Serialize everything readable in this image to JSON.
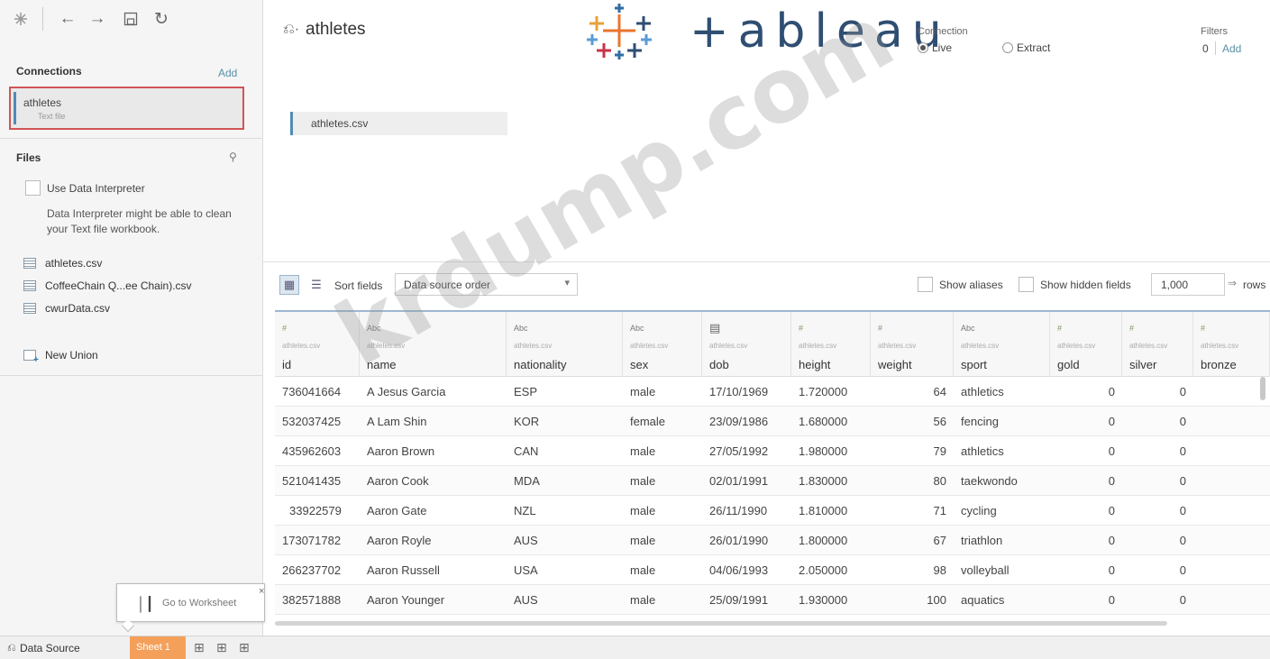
{
  "topbar": {
    "icons": [
      "tableau-logo-icon",
      "back-icon",
      "forward-icon",
      "save-icon",
      "refresh-icon"
    ]
  },
  "left_pane": {
    "connections_title": "Connections",
    "connections_add": "Add",
    "connection": {
      "name": "athletes",
      "type": "Text file"
    },
    "files_title": "Files",
    "interpreter": {
      "label": "Use Data Interpreter",
      "description": "Data Interpreter might be able to clean your Text file workbook."
    },
    "files": [
      {
        "label": "athletes.csv"
      },
      {
        "label": "CoffeeChain Q...ee Chain).csv"
      },
      {
        "label": "cwurData.csv"
      }
    ],
    "new_union": "New Union"
  },
  "header": {
    "datasource_name": "athletes",
    "logo_text": "+ableau",
    "connection_label": "Connection",
    "live_label": "Live",
    "extract_label": "Extract",
    "filters_label": "Filters",
    "filters_count": "0",
    "filters_add": "Add",
    "table_pill": "athletes.csv"
  },
  "toolbar": {
    "sort_label": "Sort fields",
    "sort_value": "Data source order",
    "show_aliases": "Show aliases",
    "show_hidden": "Show hidden fields",
    "rows_value": "1,000",
    "rows_unit": "rows"
  },
  "grid": {
    "source": "athletes.csv",
    "columns": [
      {
        "name": "id",
        "type": "#"
      },
      {
        "name": "name",
        "type": "Abc"
      },
      {
        "name": "nationality",
        "type": "Abc"
      },
      {
        "name": "sex",
        "type": "Abc"
      },
      {
        "name": "dob",
        "type": "date"
      },
      {
        "name": "height",
        "type": "#"
      },
      {
        "name": "weight",
        "type": "#"
      },
      {
        "name": "sport",
        "type": "Abc"
      },
      {
        "name": "gold",
        "type": "#"
      },
      {
        "name": "silver",
        "type": "#"
      },
      {
        "name": "bronze",
        "type": "#"
      }
    ],
    "rows": [
      [
        "736041664",
        "A Jesus Garcia",
        "ESP",
        "male",
        "17/10/1969",
        "1.720000",
        "64",
        "athletics",
        "0",
        "0",
        ""
      ],
      [
        "532037425",
        "A Lam Shin",
        "KOR",
        "female",
        "23/09/1986",
        "1.680000",
        "56",
        "fencing",
        "0",
        "0",
        ""
      ],
      [
        "435962603",
        "Aaron Brown",
        "CAN",
        "male",
        "27/05/1992",
        "1.980000",
        "79",
        "athletics",
        "0",
        "0",
        ""
      ],
      [
        "521041435",
        "Aaron Cook",
        "MDA",
        "male",
        "02/01/1991",
        "1.830000",
        "80",
        "taekwondo",
        "0",
        "0",
        ""
      ],
      [
        "33922579",
        "Aaron Gate",
        "NZL",
        "male",
        "26/11/1990",
        "1.810000",
        "71",
        "cycling",
        "0",
        "0",
        ""
      ],
      [
        "173071782",
        "Aaron Royle",
        "AUS",
        "male",
        "26/01/1990",
        "1.800000",
        "67",
        "triathlon",
        "0",
        "0",
        ""
      ],
      [
        "266237702",
        "Aaron Russell",
        "USA",
        "male",
        "04/06/1993",
        "2.050000",
        "98",
        "volleyball",
        "0",
        "0",
        ""
      ],
      [
        "382571888",
        "Aaron Younger",
        "AUS",
        "male",
        "25/09/1991",
        "1.930000",
        "100",
        "aquatics",
        "0",
        "0",
        ""
      ]
    ]
  },
  "tooltip": {
    "label": "Go to Worksheet",
    "close": "×"
  },
  "tabs": {
    "data_source": "Data Source",
    "sheet": "Sheet 1"
  },
  "watermark": "krdump.com",
  "colors": {
    "accent_blue": "#4f8db3",
    "highlight_red": "#d05555",
    "sheet_tab_orange": "#f5a05a",
    "logo_orange": "#e8762d",
    "logo_navy": "#2f4e72"
  }
}
